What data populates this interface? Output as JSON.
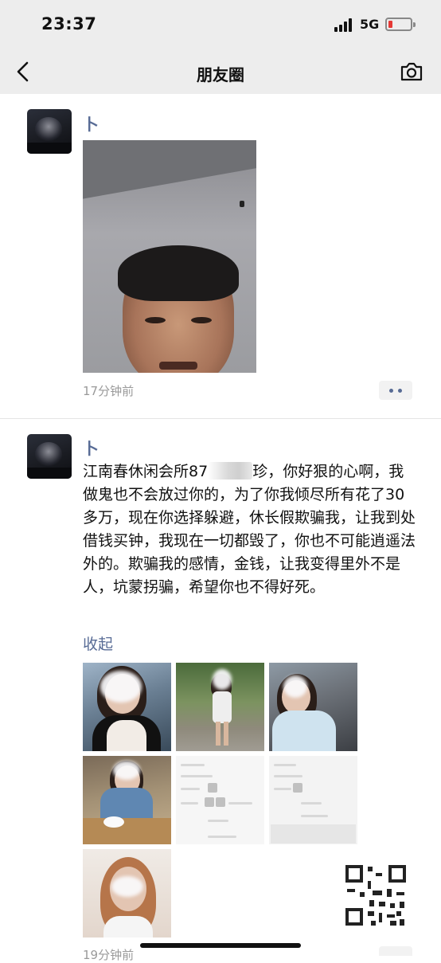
{
  "status_bar": {
    "time": "23:37",
    "network": "5G"
  },
  "nav": {
    "title": "朋友圈"
  },
  "posts": [
    {
      "username": "卜",
      "time": "17分钟前"
    },
    {
      "username": "卜",
      "text_before": "江南春休闲会所87",
      "text_after": "珍，你好狠的心啊，我做鬼也不会放过你的，为了你我倾尽所有花了30多万，现在你选择躲避，休长假欺骗我，让我到处借钱买钟，我现在一切都毁了，你也不可能逍遥法外的。欺骗我的感情，金钱，让我变得里外不是人，坑蒙拐骗，希望你也不得好死。",
      "collapse": "收起",
      "time": "19分钟前"
    }
  ],
  "colors": {
    "link": "#576b95",
    "header_bg": "#ededed",
    "muted": "#9a9a9a"
  }
}
